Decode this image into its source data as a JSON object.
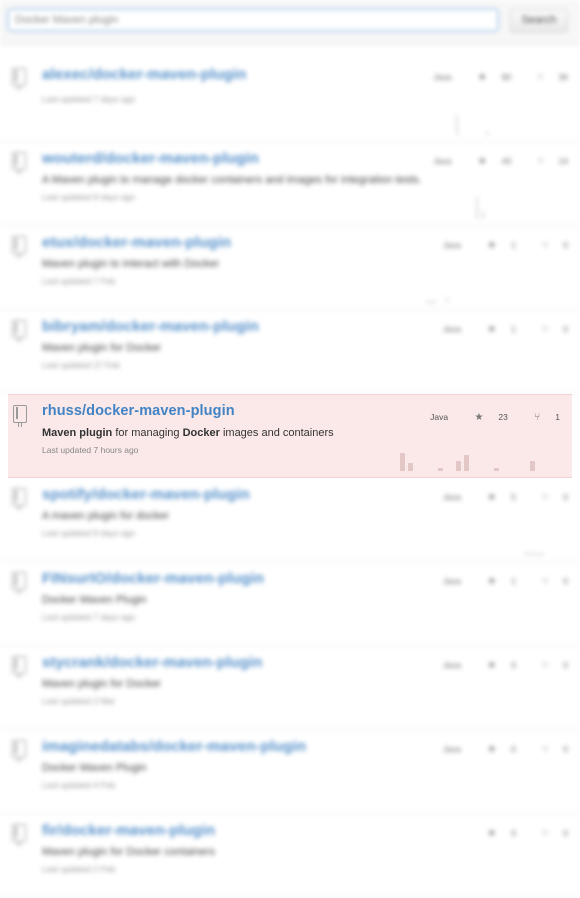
{
  "search": {
    "query": "Docker Maven plugin",
    "button_label": "Search"
  },
  "repos": [
    {
      "name": "alexec/docker-maven-plugin",
      "description": "",
      "updated": "Last updated 7 days ago",
      "language": "Java",
      "stars": "90",
      "forks": "36"
    },
    {
      "name": "wouterd/docker-maven-plugin",
      "description": "A Maven plugin to manage docker containers and images for integration tests.",
      "updated": "Last updated 8 days ago",
      "language": "Java",
      "stars": "43",
      "forks": "14"
    },
    {
      "name": "etux/docker-maven-plugin",
      "description": "Maven plugin to interact with Docker",
      "updated": "Last updated 7 Feb",
      "language": "Java",
      "stars": "1",
      "forks": "0"
    },
    {
      "name": "bibryam/docker-maven-plugin",
      "description": "Maven plugin for Docker",
      "updated": "Last updated 27 Feb",
      "language": "Java",
      "stars": "1",
      "forks": "0"
    },
    {
      "name": "rhuss/docker-maven-plugin",
      "description_bold_1": "Maven plugin",
      "description_mid": " for managing ",
      "description_bold_2": "Docker",
      "description_end": " images and containers",
      "updated": "Last updated 7 hours ago",
      "language": "Java",
      "stars": "23",
      "forks": "1"
    },
    {
      "name": "spotify/docker-maven-plugin",
      "description": "A maven plugin for docker",
      "updated": "Last updated 9 days ago",
      "language": "Java",
      "stars": "5",
      "forks": "0"
    },
    {
      "name": "FINsurIO/docker-maven-plugin",
      "description": "Docker Maven Plugin",
      "updated": "Last updated 7 days ago",
      "language": "Java",
      "stars": "1",
      "forks": "0"
    },
    {
      "name": "stycrank/docker-maven-plugin",
      "description": "Maven plugin for Docker",
      "updated": "Last updated 2 Mar",
      "language": "Java",
      "stars": "0",
      "forks": "0"
    },
    {
      "name": "imaginedatabs/docker-maven-plugin",
      "description": "Docker Maven Plugin",
      "updated": "Last updated 4 Feb",
      "language": "Java",
      "stars": "0",
      "forks": "0"
    },
    {
      "name": "fir/docker-maven-plugin",
      "description": "Maven plugin for Docker containers",
      "updated": "Last updated 2 Feb",
      "language": "",
      "stars": "0",
      "forks": "0"
    }
  ]
}
